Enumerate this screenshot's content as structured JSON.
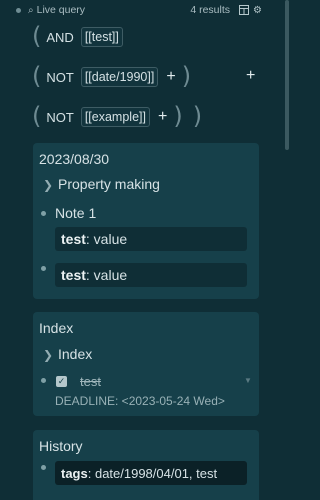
{
  "query_header": {
    "title": "Live query",
    "results": "4 results",
    "icons": [
      "table-view-icon",
      "settings-icon"
    ]
  },
  "filters": [
    {
      "operator": "AND",
      "value": "[[test]]"
    },
    {
      "operator": "NOT",
      "value": "[[date/1990]]"
    },
    {
      "operator": "NOT",
      "value": "[[example]]"
    }
  ],
  "plus_symbol": "+",
  "panels": {
    "date_block": {
      "title": "2023/08/30",
      "child": "Property making",
      "note": "Note 1",
      "prop1_key": "test",
      "prop1_value": ": value",
      "prop2_key": "test",
      "prop2_value": ": value"
    },
    "index_block": {
      "title": "Index",
      "child": "Index",
      "task": "test",
      "deadline": "DEADLINE: <2023-05-24 Wed>"
    },
    "history_block": {
      "title": "History",
      "tag_key": "tags",
      "tag_value": ": date/1998/04/01, test"
    }
  }
}
